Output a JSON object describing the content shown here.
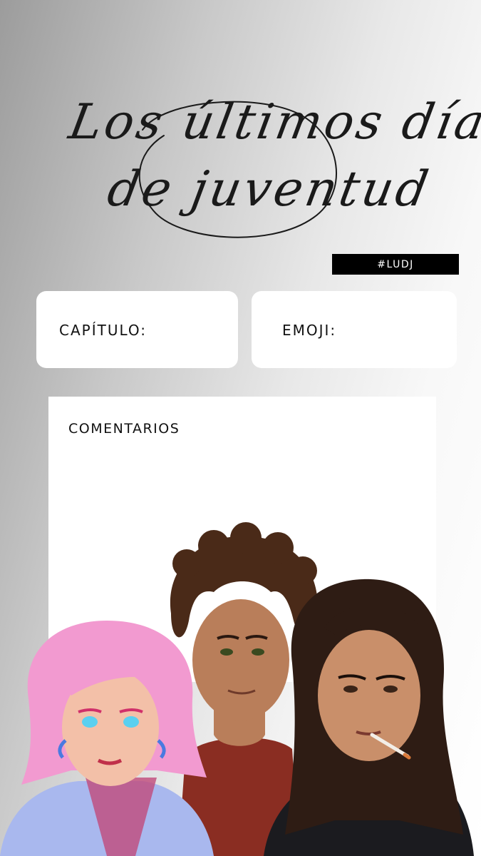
{
  "title": {
    "line1": "Los últimos días",
    "line2": "de juventud"
  },
  "hashtag": "#LUDJ",
  "fields": {
    "chapter_label": "CAPÍTULO:",
    "emoji_label": "EMOJI:"
  },
  "comments": {
    "label": "COMENTARIOS"
  },
  "illustration": {
    "subject": "three-characters",
    "colors": {
      "pink_hair": "#f29ad0",
      "brown_curly_hair": "#4a2a18",
      "long_dark_hair": "#2e1c14",
      "skin_light": "#f3c0a8",
      "skin_tan": "#b97e5a",
      "skin_medium": "#c98f6a",
      "red_shirt": "#8a2d22",
      "black_hoodie": "#1b1b1f",
      "lilac_top": "#a9b8ee"
    }
  }
}
